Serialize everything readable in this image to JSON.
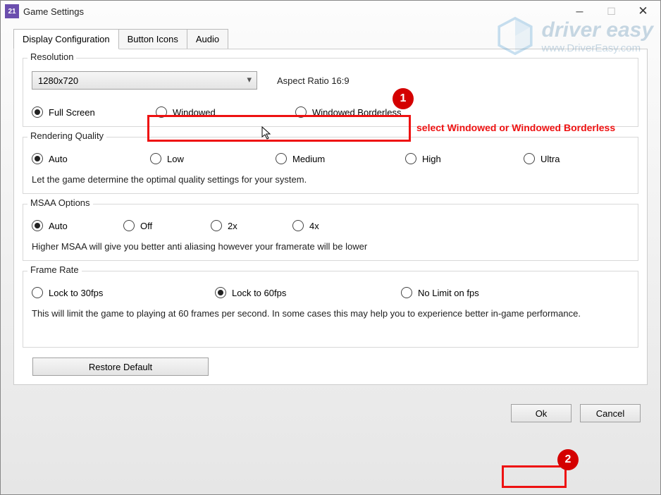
{
  "titlebar": {
    "icon_text": "21",
    "title": "Game Settings"
  },
  "tabs": {
    "items": [
      "Display Configuration",
      "Button Icons",
      "Audio"
    ],
    "active": 0
  },
  "resolution": {
    "legend": "Resolution",
    "selected": "1280x720",
    "aspect": "Aspect Ratio 16:9",
    "modes": [
      {
        "label": "Full Screen",
        "checked": true
      },
      {
        "label": "Windowed",
        "checked": false
      },
      {
        "label": "Windowed Borderless",
        "checked": false
      }
    ]
  },
  "rendering": {
    "legend": "Rendering Quality",
    "options": [
      {
        "label": "Auto",
        "checked": true
      },
      {
        "label": "Low",
        "checked": false
      },
      {
        "label": "Medium",
        "checked": false
      },
      {
        "label": "High",
        "checked": false
      },
      {
        "label": "Ultra",
        "checked": false
      }
    ],
    "desc": "Let the game determine the optimal quality settings for your system."
  },
  "msaa": {
    "legend": "MSAA Options",
    "options": [
      {
        "label": "Auto",
        "checked": true
      },
      {
        "label": "Off",
        "checked": false
      },
      {
        "label": "2x",
        "checked": false
      },
      {
        "label": "4x",
        "checked": false
      }
    ],
    "desc": "Higher MSAA will give you better anti aliasing however your framerate will be lower"
  },
  "framerate": {
    "legend": "Frame Rate",
    "options": [
      {
        "label": "Lock  to 30fps",
        "checked": false
      },
      {
        "label": "Lock to 60fps",
        "checked": true
      },
      {
        "label": "No Limit on fps",
        "checked": false
      }
    ],
    "desc": "This will limit the game to playing at 60 frames per second. In some cases this may help you to experience better in-game performance."
  },
  "buttons": {
    "restore": "Restore Default",
    "ok": "Ok",
    "cancel": "Cancel"
  },
  "annotations": {
    "badge1": "1",
    "badge2": "2",
    "text1": "select Windowed or Windowed Borderless"
  },
  "watermark": {
    "line1": "driver easy",
    "line2": "www.DriverEasy.com"
  }
}
